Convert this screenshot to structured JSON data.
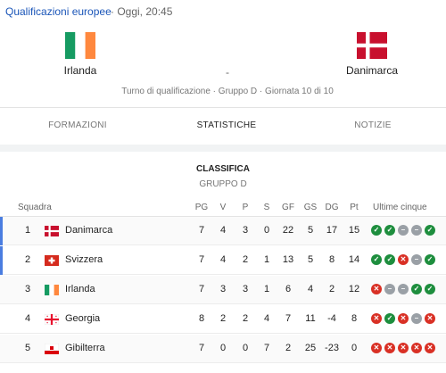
{
  "header": {
    "competition": "Qualificazioni europee",
    "date": "· Oggi, 20:45",
    "home": "Irlanda",
    "away": "Danimarca",
    "score": "-",
    "round": "Turno di qualificazione · Gruppo D · Giornata 10 di 10"
  },
  "tabs": [
    "FORMAZIONI",
    "STATISTICHE",
    "NOTIZIE"
  ],
  "standings": {
    "title": "CLASSIFICA",
    "group": "GRUPPO D",
    "columns": {
      "team": "Squadra",
      "pg": "PG",
      "v": "V",
      "p": "P",
      "s": "S",
      "gf": "GF",
      "gs": "GS",
      "dg": "DG",
      "pt": "Pt",
      "form": "Ultime cinque"
    },
    "rows": [
      {
        "pos": "1",
        "team": "Danimarca",
        "flag": "denmark-flag",
        "pg": "7",
        "v": "4",
        "p": "3",
        "s": "0",
        "gf": "22",
        "gs": "5",
        "dg": "17",
        "pt": "15",
        "form": [
          "W",
          "W",
          "D",
          "D",
          "W"
        ]
      },
      {
        "pos": "2",
        "team": "Svizzera",
        "flag": "switzerland-flag",
        "pg": "7",
        "v": "4",
        "p": "2",
        "s": "1",
        "gf": "13",
        "gs": "5",
        "dg": "8",
        "pt": "14",
        "form": [
          "W",
          "W",
          "L",
          "D",
          "W"
        ]
      },
      {
        "pos": "3",
        "team": "Irlanda",
        "flag": "ireland-flag",
        "pg": "7",
        "v": "3",
        "p": "3",
        "s": "1",
        "gf": "6",
        "gs": "4",
        "dg": "2",
        "pt": "12",
        "form": [
          "L",
          "D",
          "D",
          "W",
          "W"
        ]
      },
      {
        "pos": "4",
        "team": "Georgia",
        "flag": "georgia-flag",
        "pg": "8",
        "v": "2",
        "p": "2",
        "s": "4",
        "gf": "7",
        "gs": "11",
        "dg": "-4",
        "pt": "8",
        "form": [
          "L",
          "W",
          "L",
          "D",
          "L"
        ]
      },
      {
        "pos": "5",
        "team": "Gibilterra",
        "flag": "gibraltar-flag",
        "pg": "7",
        "v": "0",
        "p": "0",
        "s": "7",
        "gf": "2",
        "gs": "25",
        "dg": "-23",
        "pt": "0",
        "form": [
          "L",
          "L",
          "L",
          "L",
          "L"
        ]
      }
    ]
  },
  "colors": {
    "link": "#1a55b8",
    "win": "#1e8e3e",
    "draw": "#9aa0a6",
    "loss": "#d93025",
    "qualify_marker": "#4a7de0"
  }
}
